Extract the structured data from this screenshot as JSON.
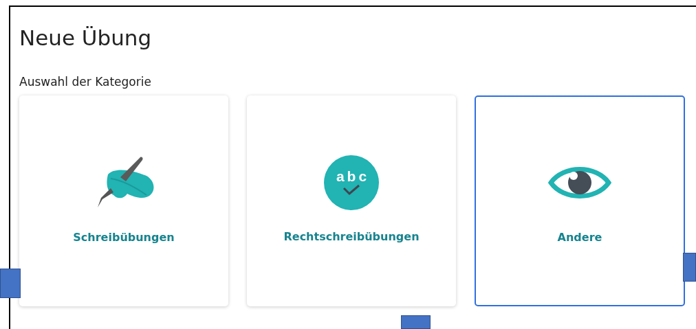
{
  "title": "Neue Übung",
  "section_label": "Auswahl der Kategorie",
  "categories": [
    {
      "kind": "writing",
      "label": "Schreibübungen",
      "selected": false
    },
    {
      "kind": "spelling",
      "label": "Rechtschreibübungen",
      "icon_text": "abc",
      "selected": false
    },
    {
      "kind": "other",
      "label": "Andere",
      "selected": true
    }
  ]
}
